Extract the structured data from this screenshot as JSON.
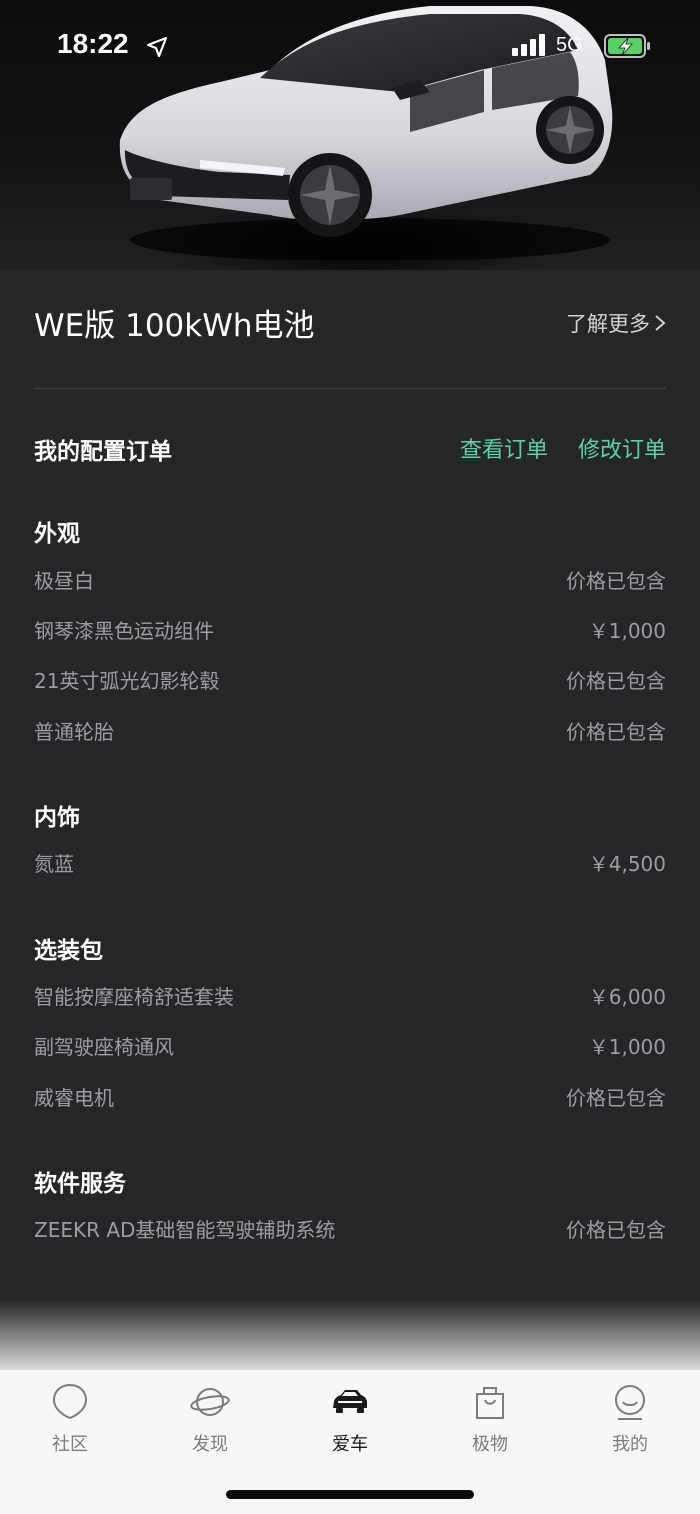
{
  "status_bar": {
    "time": "18:22",
    "network": "5G",
    "icons": [
      "location-arrow-icon",
      "signal-icon",
      "battery-charging-icon"
    ]
  },
  "vehicle": {
    "model_title": "WE版 100kWh电池",
    "learn_more_label": "了解更多",
    "body_color": "#e6e5ea"
  },
  "order": {
    "title": "我的配置订单",
    "view_order_label": "查看订单",
    "modify_order_label": "修改订单",
    "accent_color": "#5ed0a2"
  },
  "sections": [
    {
      "title": "外观",
      "items": [
        {
          "name": "极昼白",
          "price": "价格已包含"
        },
        {
          "name": "钢琴漆黑色运动组件",
          "price": "￥1,000"
        },
        {
          "name": "21英寸弧光幻影轮毂",
          "price": "价格已包含"
        },
        {
          "name": "普通轮胎",
          "price": "价格已包含"
        }
      ]
    },
    {
      "title": "内饰",
      "items": [
        {
          "name": "氮蓝",
          "price": "￥4,500"
        }
      ]
    },
    {
      "title": "选装包",
      "items": [
        {
          "name": "智能按摩座椅舒适套装",
          "price": "￥6,000"
        },
        {
          "name": "副驾驶座椅通风",
          "price": "￥1,000"
        },
        {
          "name": "威睿电机",
          "price": "价格已包含"
        }
      ]
    },
    {
      "title": "软件服务",
      "items": [
        {
          "name": "ZEEKR AD基础智能驾驶辅助系统",
          "price": "价格已包含"
        }
      ]
    }
  ],
  "tabbar": {
    "active": "爱车",
    "tabs": [
      {
        "label": "社区",
        "icon": "community-icon"
      },
      {
        "label": "发现",
        "icon": "planet-icon"
      },
      {
        "label": "爱车",
        "icon": "car-icon"
      },
      {
        "label": "极物",
        "icon": "shopping-bag-icon"
      },
      {
        "label": "我的",
        "icon": "profile-icon"
      }
    ]
  }
}
